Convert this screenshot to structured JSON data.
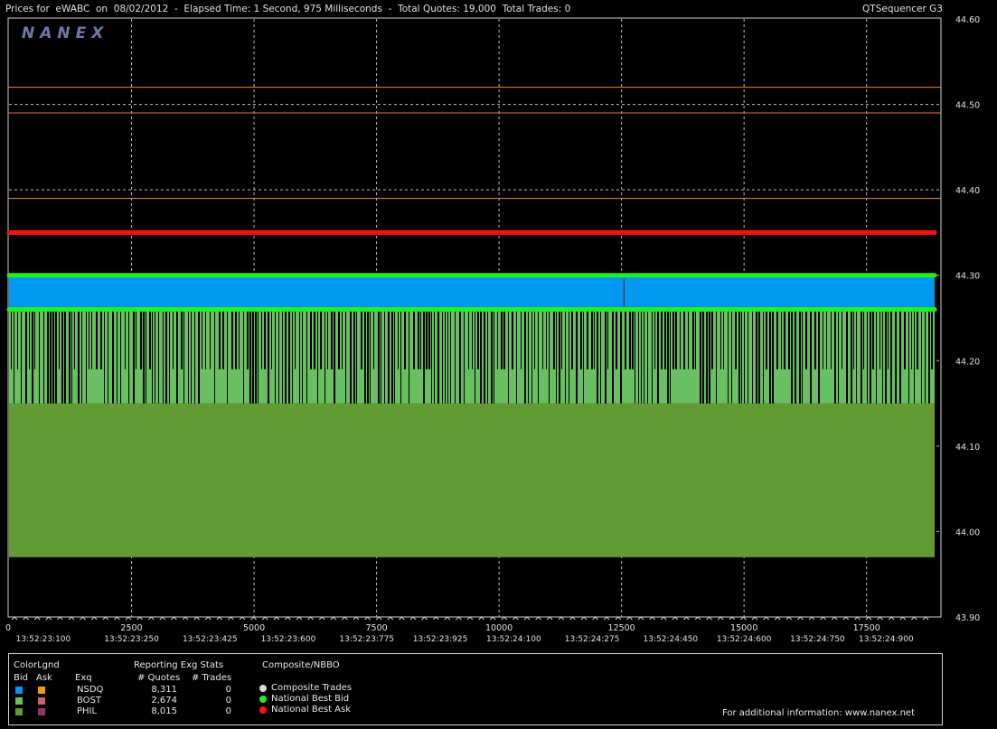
{
  "header": {
    "title_left": "Prices for  eWABC  on  08/02/2012  -  Elapsed Time: 1 Second, 975 Milliseconds  -  Total Quotes: 19,000  Total Trades: 0",
    "title_right": "QTSequencer G3"
  },
  "logo": "NANEX",
  "chart_data": {
    "type": "line",
    "title": "Prices for  eWABC  on  08/02/2012  -  Elapsed Time: 1 Second, 975 Milliseconds  -  Total Quotes: 19,000  Total Trades: 0",
    "xlabel": "",
    "ylabel": "",
    "xlim": [
      0,
      19000
    ],
    "ylim": [
      43.9,
      44.6
    ],
    "grid": true,
    "y_ticks": [
      "44.60",
      "44.50",
      "44.40",
      "44.30",
      "44.20",
      "44.10",
      "44.00",
      "43.90"
    ],
    "y_tick_values": [
      44.6,
      44.5,
      44.4,
      44.3,
      44.2,
      44.1,
      44.0,
      43.9
    ],
    "x_ticks": [
      "0",
      "2500",
      "5000",
      "7500",
      "10000",
      "12500",
      "15000",
      "17500"
    ],
    "x_tick_values": [
      0,
      2500,
      5000,
      7500,
      10000,
      12500,
      15000,
      17500
    ],
    "time_labels": [
      "13:52:23:100",
      "13:52:23:250",
      "13:52:23:425",
      "13:52:23:600",
      "13:52:23:775",
      "13:52:23:925",
      "13:52:24:100",
      "13:52:24:275",
      "13:52:24:450",
      "13:52:24:600",
      "13:52:24:750",
      "13:52:24:900"
    ],
    "time_label_x": [
      700,
      2500,
      4100,
      5700,
      7300,
      8800,
      10300,
      11900,
      13500,
      15000,
      16500,
      17900
    ],
    "series": [
      {
        "name": "NSDQ",
        "role": "ask",
        "color": "#f08030",
        "y": 44.52,
        "x_range": [
          0,
          19000
        ]
      },
      {
        "name": "BOST",
        "role": "ask",
        "color": "#e07060",
        "y": 44.49,
        "x_range": [
          0,
          19000
        ]
      },
      {
        "name": "PHIL",
        "role": "ask",
        "color": "#f09040",
        "y": 44.39,
        "x_range": [
          0,
          19000
        ]
      },
      {
        "name": "National Best Ask",
        "color": "#ff1010",
        "y": 44.35,
        "x_range": [
          0,
          19000
        ]
      },
      {
        "name": "National Best Bid",
        "color": "#22ee22",
        "y_high": 44.3,
        "y_low": 44.26,
        "x_range": [
          0,
          19000
        ]
      },
      {
        "name": "NSDQ",
        "role": "bid",
        "color": "#0098f0",
        "band": [
          44.26,
          44.3
        ],
        "x_range": [
          0,
          19000
        ]
      },
      {
        "name": "BOST",
        "role": "bid",
        "color": "#68c060",
        "band": [
          44.15,
          44.26
        ],
        "x_range": [
          0,
          19000
        ]
      },
      {
        "name": "PHIL",
        "role": "bid",
        "color": "#649a34",
        "band": [
          43.97,
          44.15
        ],
        "x_range": [
          0,
          19000
        ]
      }
    ]
  },
  "legend": {
    "colorlgnd": "ColorLgnd",
    "bid": "Bid",
    "ask": "Ask",
    "exq": "Exq",
    "stats_title": "Reporting Exg Stats",
    "quotes_header": "# Quotes",
    "trades_header": "# Trades",
    "rows": [
      {
        "exq": "NSDQ",
        "quotes": "8,311",
        "trades": "0",
        "bid_color": "#0098f0",
        "ask_color": "#f09a20"
      },
      {
        "exq": "BOST",
        "quotes": "2,674",
        "trades": "0",
        "bid_color": "#68c060",
        "ask_color": "#d06070"
      },
      {
        "exq": "PHIL",
        "quotes": "8,015",
        "trades": "0",
        "bid_color": "#649a34",
        "ask_color": "#903868"
      }
    ],
    "composite_title": "Composite/NBBO",
    "composite_items": [
      {
        "label": "Composite Trades",
        "color": "#d8d8d8"
      },
      {
        "label": "National Best Bid",
        "color": "#22ee22"
      },
      {
        "label": "National Best Ask",
        "color": "#ff1010"
      }
    ],
    "footer": "For additional information: www.nanex.net"
  }
}
